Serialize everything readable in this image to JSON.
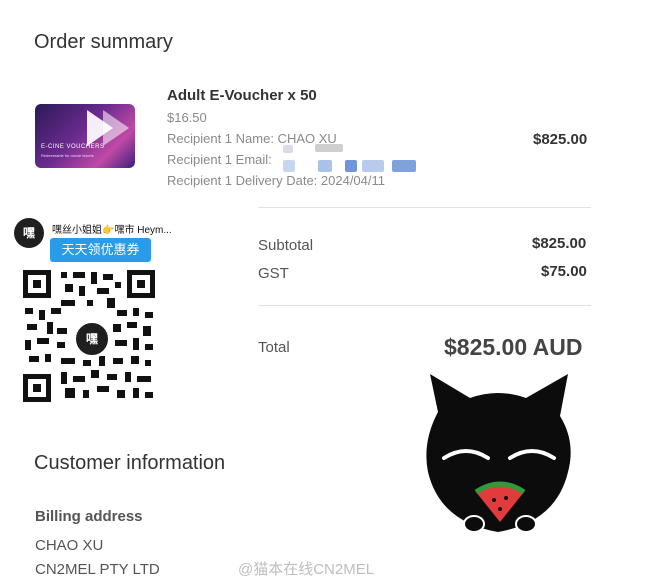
{
  "order": {
    "heading": "Order summary",
    "item": {
      "title": "Adult E-Voucher x 50",
      "unit_price": "$16.50",
      "recipient_name": "Recipient 1 Name: CHAO XU",
      "recipient_email": "Recipient 1 Email:",
      "delivery_date": "Recipient 1 Delivery Date: 2024/04/11",
      "line_total": "$825.00",
      "voucher_brand": "E-CINE VOUCHERS",
      "voucher_sub": "Redeemable for movie tickets"
    },
    "subtotal_label": "Subtotal",
    "subtotal_value": "$825.00",
    "gst_label": "GST",
    "gst_value": "$75.00",
    "total_label": "Total",
    "total_value": "$825.00 AUD"
  },
  "customer": {
    "heading": "Customer information",
    "billing_label": "Billing address",
    "name": "CHAO XU",
    "company": "CN2MEL PTY LTD"
  },
  "overlay": {
    "account_name": "嘿丝小姐姐👉嘿市 Heym...",
    "badge": "天天领优惠券",
    "qr_center": "嘿",
    "watermark": "@猫本在线CN2MEL"
  }
}
